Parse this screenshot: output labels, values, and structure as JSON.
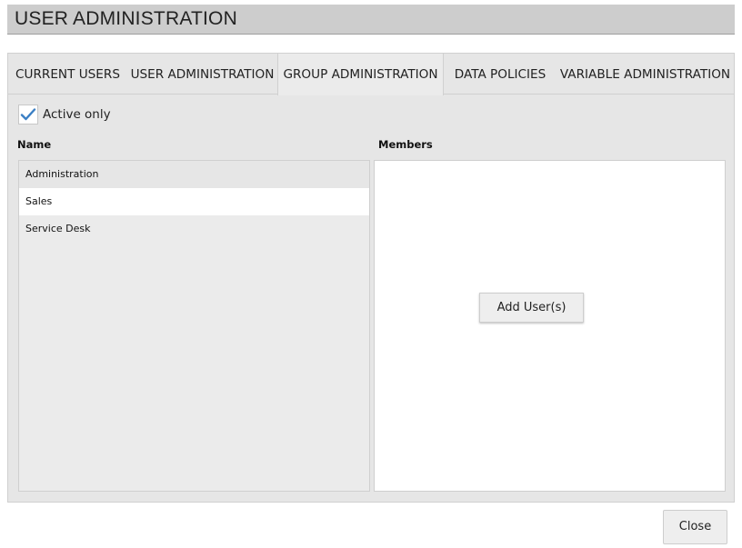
{
  "window": {
    "title": "USER ADMINISTRATION"
  },
  "tabs": [
    {
      "label": "CURRENT USERS",
      "active": false
    },
    {
      "label": "USER ADMINISTRATION",
      "active": false
    },
    {
      "label": "GROUP ADMINISTRATION",
      "active": true
    },
    {
      "label": "DATA POLICIES",
      "active": false
    },
    {
      "label": "VARIABLE ADMINISTRATION",
      "active": false
    }
  ],
  "filter": {
    "active_only_label": "Active only",
    "active_only_checked": true
  },
  "columns": {
    "name_header": "Name",
    "members_header": "Members"
  },
  "groups": [
    {
      "label": "Administration",
      "state": "hover"
    },
    {
      "label": "Sales",
      "state": "selected"
    },
    {
      "label": "Service Desk",
      "state": "normal"
    }
  ],
  "members": {
    "add_user_label": "Add User(s)"
  },
  "footer": {
    "close_label": "Close"
  },
  "colors": {
    "accent_check": "#3b7fc4",
    "title_bar": "#cdcdcd",
    "panel_bg": "#e6e6e6"
  }
}
